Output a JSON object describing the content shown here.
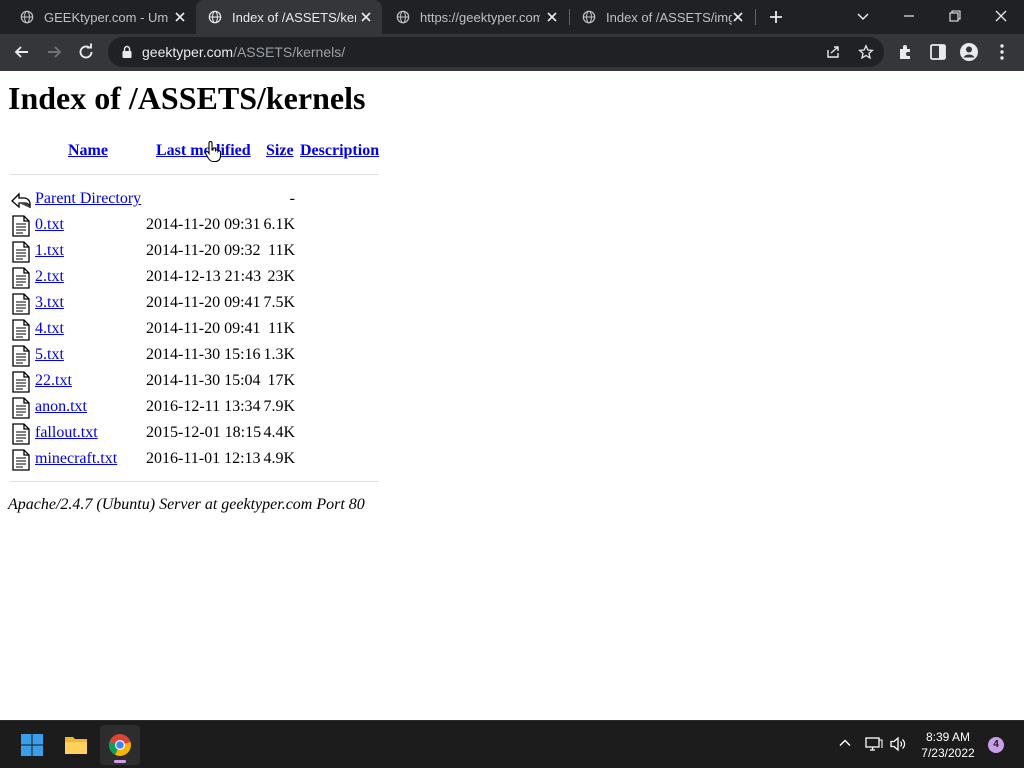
{
  "browser": {
    "tabs": [
      {
        "title": "GEEKtyper.com - Umm"
      },
      {
        "title": "Index of /ASSETS/kernels"
      },
      {
        "title": "https://geektyper.com/"
      },
      {
        "title": "Index of /ASSETS/img"
      }
    ],
    "url": {
      "host": "geektyper.com",
      "path": "/ASSETS/kernels/"
    }
  },
  "page": {
    "title": "Index of /ASSETS/kernels",
    "columns": {
      "name": "Name",
      "modified": "Last modified",
      "size": "Size",
      "description": "Description"
    },
    "parent": {
      "label": "Parent Directory",
      "size": "-"
    },
    "files": [
      {
        "name": "0.txt",
        "modified": "2014-11-20 09:31",
        "size": "6.1K"
      },
      {
        "name": "1.txt",
        "modified": "2014-11-20 09:32",
        "size": "11K"
      },
      {
        "name": "2.txt",
        "modified": "2014-12-13 21:43",
        "size": "23K"
      },
      {
        "name": "3.txt",
        "modified": "2014-11-20 09:41",
        "size": "7.5K"
      },
      {
        "name": "4.txt",
        "modified": "2014-11-20 09:41",
        "size": "11K"
      },
      {
        "name": "5.txt",
        "modified": "2014-11-30 15:16",
        "size": "1.3K"
      },
      {
        "name": "22.txt",
        "modified": "2014-11-30 15:04",
        "size": "17K"
      },
      {
        "name": "anon.txt",
        "modified": "2016-12-11 13:34",
        "size": "7.9K"
      },
      {
        "name": "fallout.txt",
        "modified": "2015-12-01 18:15",
        "size": "4.4K"
      },
      {
        "name": "minecraft.txt",
        "modified": "2016-11-01 12:13",
        "size": "4.9K"
      }
    ],
    "address": "Apache/2.4.7 (Ubuntu) Server at geektyper.com Port 80"
  },
  "taskbar": {
    "time": "8:39 AM",
    "date": "7/23/2022",
    "notification_count": "4"
  },
  "colors": {
    "link": "#0000ee",
    "tab_strip": "#202124",
    "toolbar": "#35363a",
    "taskbar": "#1c1c1c"
  }
}
